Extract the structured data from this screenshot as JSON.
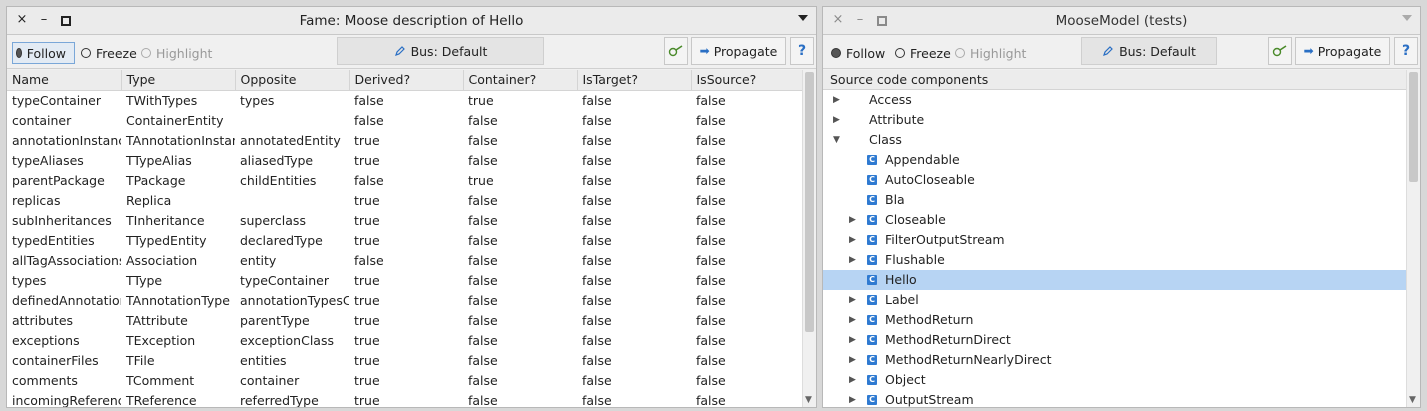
{
  "left_window": {
    "title": "Fame: Moose description of Hello",
    "controls": {
      "close": "×",
      "minimize": "–"
    },
    "toolbar": {
      "follow": "Follow",
      "freeze": "Freeze",
      "highlight": "Highlight",
      "bus": "Bus: Default",
      "propagate": "Propagate",
      "help": "?"
    },
    "columns": [
      "Name",
      "Type",
      "Opposite",
      "Derived?",
      "Container?",
      "IsTarget?",
      "IsSource?"
    ],
    "rows": [
      [
        "typeContainer",
        "TWithTypes",
        "types",
        "false",
        "true",
        "false",
        "false"
      ],
      [
        "container",
        "ContainerEntity",
        "",
        "false",
        "false",
        "false",
        "false"
      ],
      [
        "annotationInstances",
        "TAnnotationInstance",
        "annotatedEntity",
        "true",
        "false",
        "false",
        "false"
      ],
      [
        "typeAliases",
        "TTypeAlias",
        "aliasedType",
        "true",
        "false",
        "false",
        "false"
      ],
      [
        "parentPackage",
        "TPackage",
        "childEntities",
        "false",
        "true",
        "false",
        "false"
      ],
      [
        "replicas",
        "Replica",
        "",
        "true",
        "false",
        "false",
        "false"
      ],
      [
        "subInheritances",
        "TInheritance",
        "superclass",
        "true",
        "false",
        "false",
        "false"
      ],
      [
        "typedEntities",
        "TTypedEntity",
        "declaredType",
        "true",
        "false",
        "false",
        "false"
      ],
      [
        "allTagAssociations",
        "Association",
        "entity",
        "false",
        "false",
        "false",
        "false"
      ],
      [
        "types",
        "TType",
        "typeContainer",
        "true",
        "false",
        "false",
        "false"
      ],
      [
        "definedAnnotationTypes",
        "TAnnotationType",
        "annotationTypesContainer",
        "true",
        "false",
        "false",
        "false"
      ],
      [
        "attributes",
        "TAttribute",
        "parentType",
        "true",
        "false",
        "false",
        "false"
      ],
      [
        "exceptions",
        "TException",
        "exceptionClass",
        "true",
        "false",
        "false",
        "false"
      ],
      [
        "containerFiles",
        "TFile",
        "entities",
        "true",
        "false",
        "false",
        "false"
      ],
      [
        "comments",
        "TComment",
        "container",
        "true",
        "false",
        "false",
        "false"
      ],
      [
        "incomingReferences",
        "TReference",
        "referredType",
        "true",
        "false",
        "false",
        "false"
      ]
    ]
  },
  "right_window": {
    "title": "MooseModel (tests)",
    "controls": {
      "close": "×",
      "minimize": "–"
    },
    "toolbar": {
      "follow": "Follow",
      "freeze": "Freeze",
      "highlight": "Highlight",
      "bus": "Bus: Default",
      "propagate": "Propagate",
      "help": "?"
    },
    "tree_header": "Source code components",
    "tree": [
      {
        "label": "Access",
        "level": 0,
        "state": "collapsed",
        "icon": false
      },
      {
        "label": "Attribute",
        "level": 0,
        "state": "collapsed",
        "icon": false
      },
      {
        "label": "Class",
        "level": 0,
        "state": "expanded",
        "icon": false
      },
      {
        "label": "Appendable",
        "level": 1,
        "state": "leaf",
        "icon": true
      },
      {
        "label": "AutoCloseable",
        "level": 1,
        "state": "leaf",
        "icon": true
      },
      {
        "label": "Bla",
        "level": 1,
        "state": "leaf",
        "icon": true
      },
      {
        "label": "Closeable",
        "level": 1,
        "state": "collapsed",
        "icon": true
      },
      {
        "label": "FilterOutputStream",
        "level": 1,
        "state": "collapsed",
        "icon": true
      },
      {
        "label": "Flushable",
        "level": 1,
        "state": "collapsed",
        "icon": true
      },
      {
        "label": "Hello",
        "level": 1,
        "state": "leaf",
        "icon": true,
        "selected": true
      },
      {
        "label": "Label",
        "level": 1,
        "state": "collapsed",
        "icon": true
      },
      {
        "label": "MethodReturn",
        "level": 1,
        "state": "collapsed",
        "icon": true
      },
      {
        "label": "MethodReturnDirect",
        "level": 1,
        "state": "collapsed",
        "icon": true
      },
      {
        "label": "MethodReturnNearlyDirect",
        "level": 1,
        "state": "collapsed",
        "icon": true
      },
      {
        "label": "Object",
        "level": 1,
        "state": "collapsed",
        "icon": true
      },
      {
        "label": "OutputStream",
        "level": 1,
        "state": "collapsed",
        "icon": true
      }
    ]
  },
  "colors": {
    "selection": "#b7d4f3",
    "class_icon": "#2f7ad1",
    "help_blue": "#2a6fc4",
    "window_bg": "#f0f0f0"
  },
  "icons": {
    "class_icon_letter": "C",
    "collapsed_arrow": "▶",
    "expanded_arrow": "▼",
    "propagate_arrow": "➡",
    "scroll_down": "▼"
  }
}
